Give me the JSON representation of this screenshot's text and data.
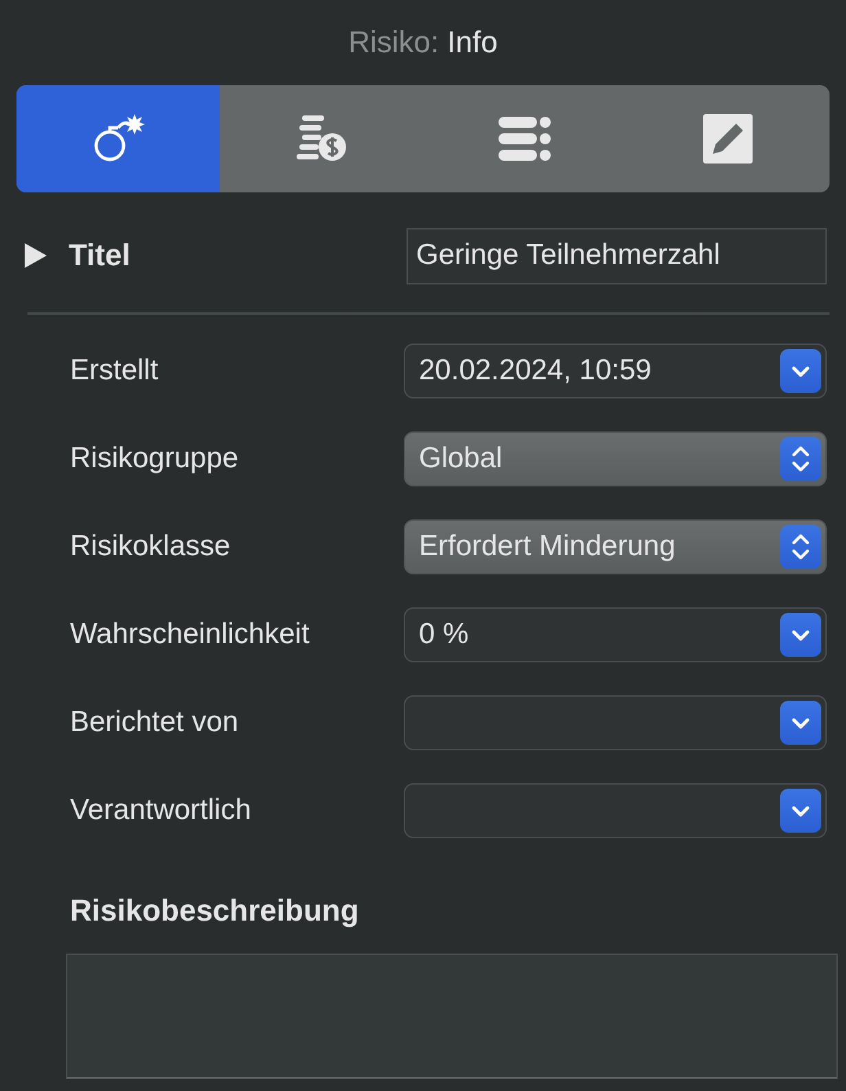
{
  "header": {
    "prefix": "Risiko:",
    "title": "Info"
  },
  "tabs": [
    {
      "kind": "bomb",
      "selected": true
    },
    {
      "kind": "coins",
      "selected": false
    },
    {
      "kind": "list",
      "selected": false
    },
    {
      "kind": "edit",
      "selected": false
    }
  ],
  "title_section": {
    "label": "Titel",
    "expanded": false,
    "value": "Geringe Teilnehmerzahl"
  },
  "fields": [
    {
      "label": "Erstellt",
      "kind": "combo",
      "value": "20.02.2024, 10:59"
    },
    {
      "label": "Risikogruppe",
      "kind": "popup",
      "value": "Global"
    },
    {
      "label": "Risikoklasse",
      "kind": "popup",
      "value": "Erfordert Minderung"
    },
    {
      "label": "Wahrscheinlichkeit",
      "kind": "combo",
      "value": "0 %"
    },
    {
      "label": "Berichtet von",
      "kind": "combo"
    },
    {
      "label": "Verantwortlich",
      "kind": "combo"
    }
  ],
  "description": {
    "label": "Risikobeschreibung"
  }
}
